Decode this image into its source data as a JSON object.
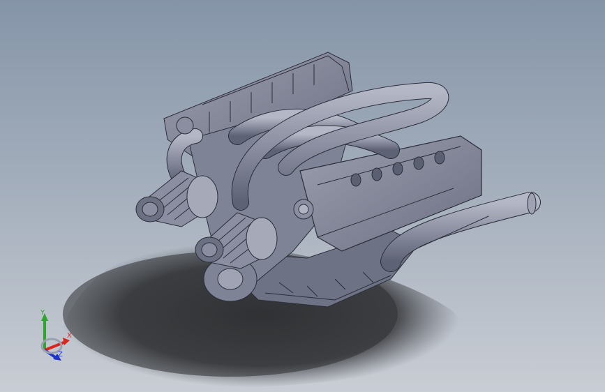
{
  "viewport": {
    "background_top": "#8595a8",
    "background_bottom": "#c9cdd4"
  },
  "model": {
    "body_color": "#7e8396",
    "highlight_color": "#a2a6b6",
    "edge_color": "#2b2d38",
    "shadow_color": "#2f3033"
  },
  "triad": {
    "label_x": "X",
    "label_y": "Y",
    "label_z": "Z",
    "color_x": "#d9261c",
    "color_y": "#2fa52f",
    "color_z": "#2035c8",
    "icon": "coordinate-triad-icon"
  }
}
